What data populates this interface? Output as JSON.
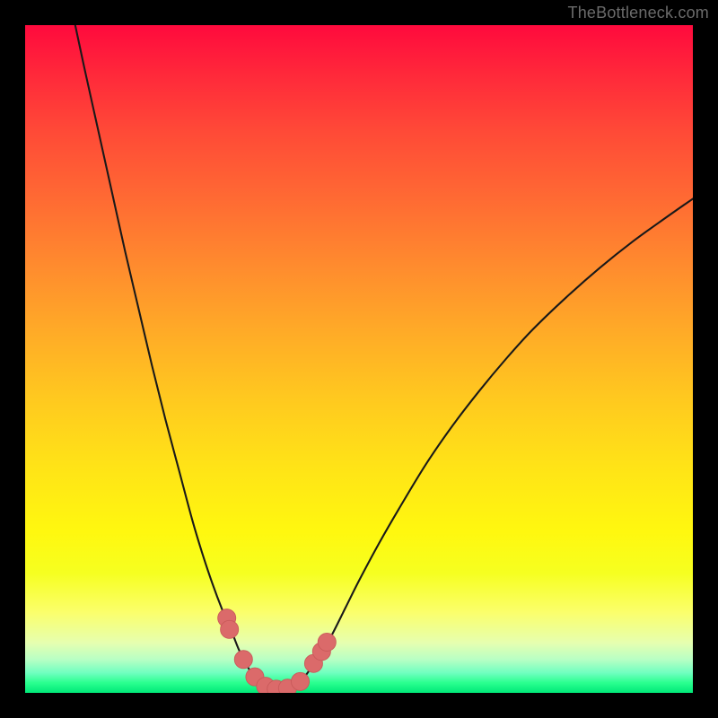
{
  "watermark": "TheBottleneck.com",
  "colors": {
    "frame": "#000000",
    "curve": "#191919",
    "marker_fill": "#db6a6a",
    "marker_stroke": "#c95a5a"
  },
  "chart_data": {
    "type": "line",
    "title": "",
    "xlabel": "",
    "ylabel": "",
    "xlim": [
      0,
      100
    ],
    "ylim": [
      0,
      100
    ],
    "grid": false,
    "legend": false,
    "annotations": [],
    "series": [
      {
        "name": "left-branch",
        "x": [
          7.5,
          9,
          11,
          13,
          15,
          17,
          19,
          21,
          23,
          25,
          26.5,
          28,
          29.5,
          31,
          32,
          33,
          34,
          35
        ],
        "y": [
          100,
          93,
          84,
          75,
          66,
          57.5,
          49,
          41,
          33.5,
          26,
          21,
          16.5,
          12.5,
          9,
          6.5,
          4.5,
          2.8,
          1.5
        ]
      },
      {
        "name": "right-branch",
        "x": [
          41,
          42,
          43,
          44.5,
          46,
          48,
          50,
          53,
          56,
          60,
          64,
          68,
          72,
          76,
          81,
          86,
          91,
          96,
          100
        ],
        "y": [
          1.5,
          2.6,
          4.0,
          6.2,
          8.8,
          12.8,
          16.8,
          22.4,
          27.6,
          34.2,
          40.0,
          45.2,
          50.0,
          54.4,
          59.2,
          63.6,
          67.6,
          71.2,
          74.0
        ]
      },
      {
        "name": "valley-floor",
        "x": [
          35,
          36,
          37,
          38,
          39,
          40,
          41
        ],
        "y": [
          1.5,
          0.9,
          0.55,
          0.45,
          0.55,
          0.9,
          1.5
        ]
      }
    ],
    "markers": {
      "name": "highlight-dots",
      "points": [
        {
          "x": 30.2,
          "y": 11.2
        },
        {
          "x": 30.6,
          "y": 9.5
        },
        {
          "x": 32.7,
          "y": 5.0
        },
        {
          "x": 34.4,
          "y": 2.4
        },
        {
          "x": 36.0,
          "y": 1.0
        },
        {
          "x": 37.6,
          "y": 0.55
        },
        {
          "x": 39.3,
          "y": 0.7
        },
        {
          "x": 41.2,
          "y": 1.7
        },
        {
          "x": 43.2,
          "y": 4.4
        },
        {
          "x": 44.4,
          "y": 6.2
        },
        {
          "x": 45.2,
          "y": 7.6
        }
      ],
      "r": 1.35
    }
  }
}
